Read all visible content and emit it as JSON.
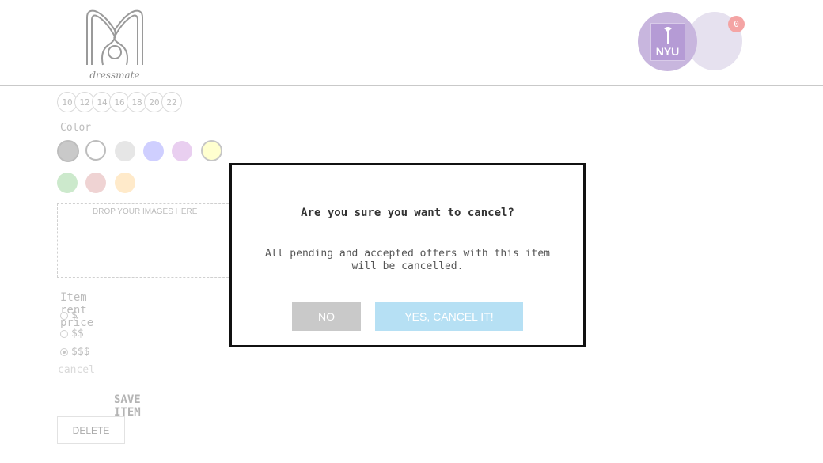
{
  "header": {
    "logo_text": "dressmate",
    "avatar_label": "NYU",
    "notification_count": "0"
  },
  "form": {
    "sizes": [
      "10",
      "12",
      "14",
      "16",
      "18",
      "20",
      "22"
    ],
    "color_label": "Color",
    "colors": [
      "#9e9e9e",
      "#ffffff",
      "#d3d3d3",
      "#a9a9ff",
      "#d8a8e4",
      "#ffffa8",
      "#a4d8a4",
      "#e2b0b0",
      "#ffd9a0"
    ],
    "dropzone_text": "DROP YOUR IMAGES HERE",
    "price_label": "Item rent price",
    "price_options": [
      "$",
      "$$",
      "$$$"
    ],
    "price_selected": "$$$",
    "cancel_link": "cancel",
    "save_label": "SAVE ITEM",
    "delete_label": "DELETE"
  },
  "modal": {
    "title": "Are you sure you want to cancel?",
    "message_line1": "All pending and accepted offers with this item",
    "message_line2": "will be cancelled.",
    "no_label": "NO",
    "yes_label": "YES, CANCEL IT!"
  }
}
